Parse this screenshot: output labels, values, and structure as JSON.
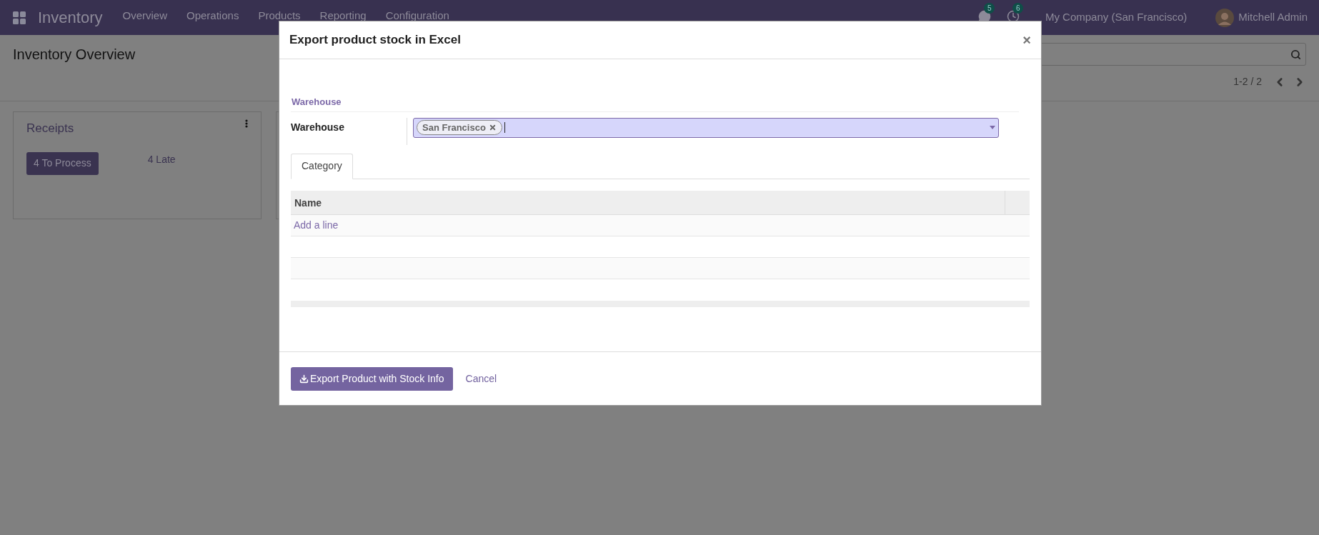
{
  "top_bar": {
    "app_name": "Inventory",
    "menu": [
      "Overview",
      "Operations",
      "Products",
      "Reporting",
      "Configuration"
    ],
    "notifications": [
      {
        "kind": "chat",
        "count": "5"
      },
      {
        "kind": "activity",
        "count": "6"
      }
    ],
    "company": "My Company (San Francisco)",
    "user": "Mitchell Admin"
  },
  "page": {
    "title": "Inventory Overview",
    "pager": "1-2 / 2",
    "cards": [
      {
        "title": "Receipts",
        "action": "4 To Process",
        "late": "4 Late"
      }
    ]
  },
  "dialog": {
    "title": "Export product stock in Excel",
    "close": "×",
    "section": "Warehouse",
    "fields": [
      {
        "label": "Warehouse",
        "tags": [
          "San Francisco"
        ]
      }
    ],
    "tabs": [
      {
        "label": "Category",
        "selected": true
      }
    ],
    "table": {
      "columns": [
        "Name"
      ],
      "add_line": "Add a line"
    },
    "buttons": [
      {
        "label": "Export Product with Stock Info",
        "kind": "primary"
      },
      {
        "label": "Cancel",
        "kind": "link"
      }
    ]
  }
}
